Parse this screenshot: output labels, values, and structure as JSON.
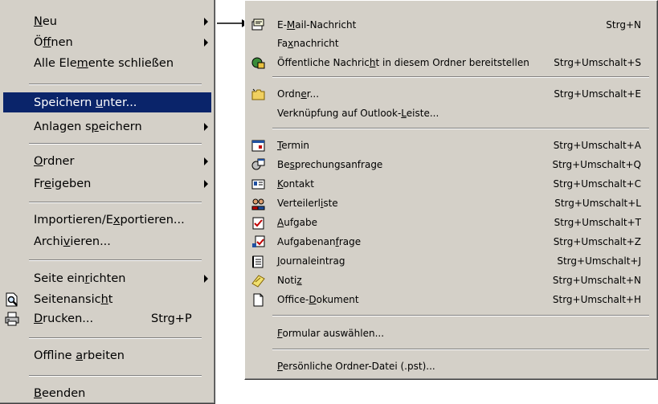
{
  "main_menu": {
    "items": [
      {
        "pre": "",
        "ul": "N",
        "post": "eu",
        "submenu": true
      },
      {
        "pre": "Ö",
        "ul": "f",
        "post": "fnen",
        "submenu": true
      },
      {
        "pre": "Alle Ele",
        "ul": "m",
        "post": "ente schließen"
      },
      {
        "pre": "Speichern ",
        "ul": "u",
        "post": "nter...",
        "highlighted": true
      },
      {
        "pre": "Anlagen s",
        "ul": "p",
        "post": "eichern",
        "submenu": true
      },
      {
        "pre": "",
        "ul": "O",
        "post": "rdner",
        "submenu": true
      },
      {
        "pre": "Fr",
        "ul": "e",
        "post": "igeben",
        "submenu": true
      },
      {
        "pre": "Importieren/E",
        "ul": "x",
        "post": "portieren..."
      },
      {
        "pre": "Archi",
        "ul": "v",
        "post": "ieren..."
      },
      {
        "pre": "Seite ein",
        "ul": "r",
        "post": "ichten",
        "submenu": true
      },
      {
        "pre": "Seitenansic",
        "ul": "h",
        "post": "t",
        "icon": "print-preview-icon"
      },
      {
        "pre": "",
        "ul": "D",
        "post": "rucken...",
        "shortcut": "Strg+P",
        "icon": "printer-icon"
      },
      {
        "pre": "Offline ",
        "ul": "a",
        "post": "rbeiten"
      },
      {
        "pre": "",
        "ul": "B",
        "post": "eenden"
      }
    ]
  },
  "sub_menu": {
    "items": [
      {
        "pre": "E-",
        "ul": "M",
        "post": "ail-Nachricht",
        "shortcut": "Strg+N",
        "icon": "email-message-icon"
      },
      {
        "pre": "Fa",
        "ul": "x",
        "post": "nachricht",
        "shortcut": ""
      },
      {
        "pre": "Öffentliche Nachric",
        "ul": "h",
        "post": "t in diesem Ordner bereitstellen",
        "shortcut": "Strg+Umschalt+S",
        "icon": "public-post-icon"
      },
      {
        "pre": "Ordn",
        "ul": "e",
        "post": "r...",
        "shortcut": "Strg+Umschalt+E",
        "icon": "folder-icon"
      },
      {
        "pre": "Verknüpfung auf Outlook-",
        "ul": "L",
        "post": "eiste...",
        "shortcut": ""
      },
      {
        "pre": "",
        "ul": "T",
        "post": "ermin",
        "shortcut": "Strg+Umschalt+A",
        "icon": "calendar-icon"
      },
      {
        "pre": "Be",
        "ul": "s",
        "post": "prechungsanfrage",
        "shortcut": "Strg+Umschalt+Q",
        "icon": "meeting-request-icon"
      },
      {
        "pre": "",
        "ul": "K",
        "post": "ontakt",
        "shortcut": "Strg+Umschalt+C",
        "icon": "contact-card-icon"
      },
      {
        "pre": "Verteilerl",
        "ul": "i",
        "post": "ste",
        "shortcut": "Strg+Umschalt+L",
        "icon": "distribution-list-icon"
      },
      {
        "pre": "",
        "ul": "A",
        "post": "ufgabe",
        "shortcut": "Strg+Umschalt+T",
        "icon": "task-icon"
      },
      {
        "pre": "Aufgabenan",
        "ul": "f",
        "post": "rage",
        "shortcut": "Strg+Umschalt+Z",
        "icon": "task-request-icon"
      },
      {
        "pre": "",
        "ul": "J",
        "post": "ournaleintrag",
        "shortcut": "Strg+Umschalt+J",
        "icon": "journal-icon"
      },
      {
        "pre": "Noti",
        "ul": "z",
        "post": "",
        "shortcut": "Strg+Umschalt+N",
        "icon": "note-icon"
      },
      {
        "pre": "Office-",
        "ul": "D",
        "post": "okument",
        "shortcut": "Strg+Umschalt+H",
        "icon": "office-document-icon"
      },
      {
        "pre": "",
        "ul": "F",
        "post": "ormular auswählen...",
        "shortcut": ""
      },
      {
        "pre": "",
        "ul": "P",
        "post": "ersönliche Ordner-Datei (.pst)...",
        "shortcut": ""
      }
    ]
  },
  "colors": {
    "menu_bg": "#d4d0c8",
    "highlight": "#0a246a"
  }
}
